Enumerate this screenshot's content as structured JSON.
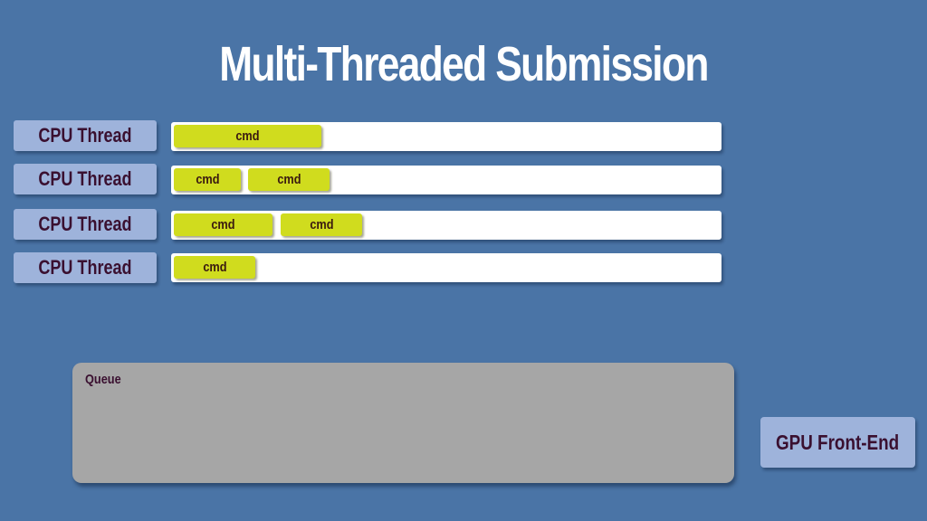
{
  "title": "Multi-Threaded Submission",
  "threads": [
    {
      "label": "CPU Thread",
      "cmds": [
        "cmd"
      ]
    },
    {
      "label": "CPU Thread",
      "cmds": [
        "cmd",
        "cmd"
      ]
    },
    {
      "label": "CPU Thread",
      "cmds": [
        "cmd",
        "cmd"
      ]
    },
    {
      "label": "CPU Thread",
      "cmds": [
        "cmd"
      ]
    }
  ],
  "queue": {
    "label": "Queue"
  },
  "gpu": {
    "label": "GPU Front-End"
  },
  "colors": {
    "background": "#4a74a6",
    "label_box": "#9eb3db",
    "cmd": "#d0dc1e",
    "track": "#ffffff",
    "queue": "#a6a6a6",
    "text_dark": "#3a1030"
  }
}
